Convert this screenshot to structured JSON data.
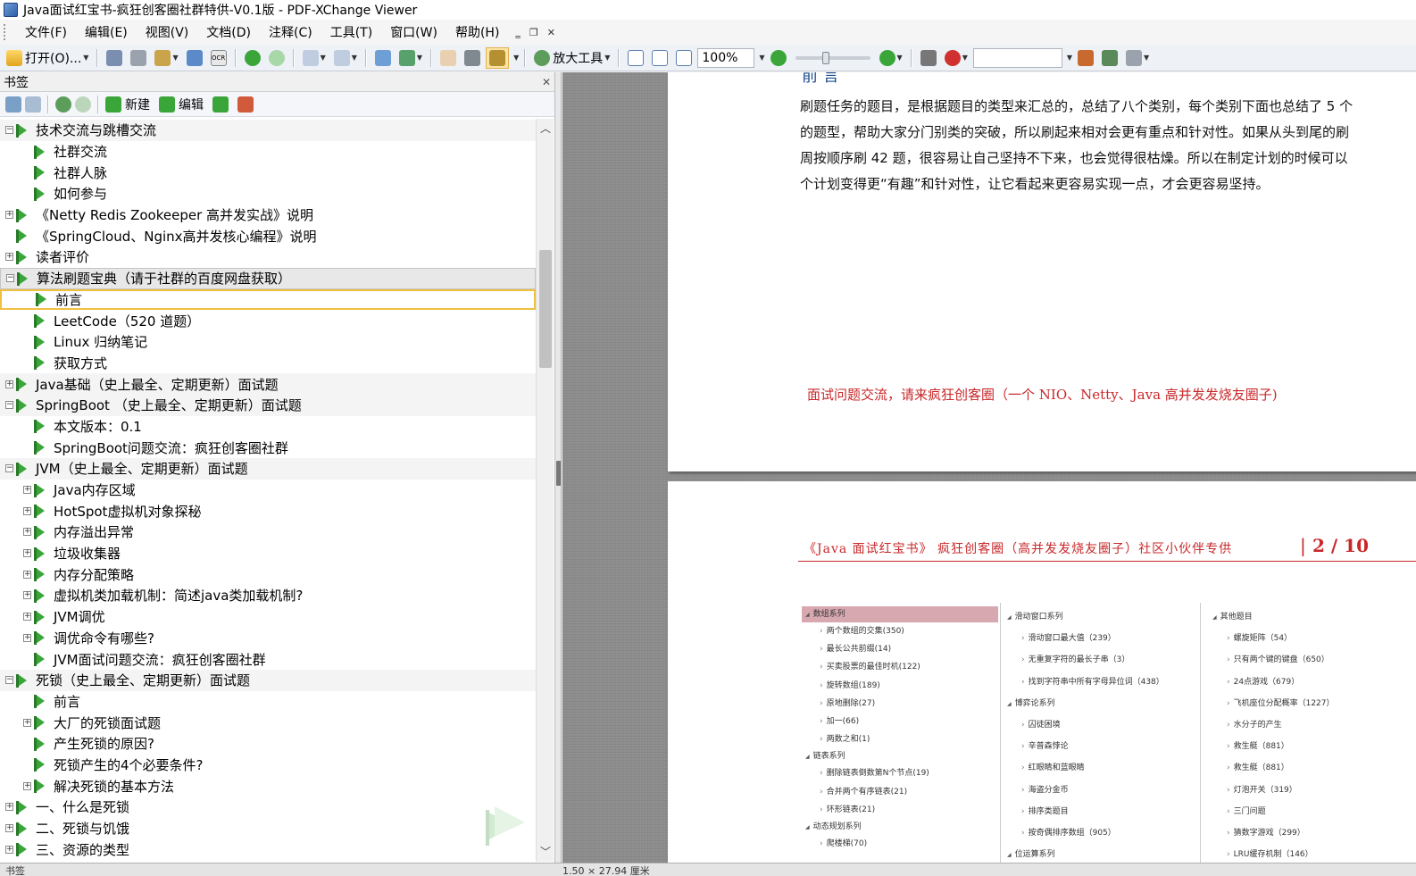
{
  "window": {
    "title": "Java面试红宝书-疯狂创客圈社群特供-V0.1版 - PDF-XChange Viewer"
  },
  "menu": [
    "文件(F)",
    "编辑(E)",
    "视图(V)",
    "文档(D)",
    "注释(C)",
    "工具(T)",
    "窗口(W)",
    "帮助(H)"
  ],
  "toolbar": {
    "open_label": "打开(O)...",
    "zoom_tool_label": "放大工具",
    "zoom_value": "100%"
  },
  "bookmarks": {
    "title": "书签",
    "new_label": "新建",
    "edit_label": "编辑",
    "items": [
      {
        "level": 0,
        "label": "技术交流与跳槽交流",
        "exp": "minus",
        "section": true
      },
      {
        "level": 1,
        "label": "社群交流",
        "exp": "none"
      },
      {
        "level": 1,
        "label": "社群人脉",
        "exp": "none"
      },
      {
        "level": 1,
        "label": "如何参与",
        "exp": "none"
      },
      {
        "level": 0,
        "label": "《Netty Redis Zookeeper 高并发实战》说明",
        "exp": "plus"
      },
      {
        "level": 0,
        "label": "《SpringCloud、Nginx高并发核心编程》说明",
        "exp": "none"
      },
      {
        "level": 0,
        "label": "读者评价",
        "exp": "plus"
      },
      {
        "level": 0,
        "label": "算法刷题宝典（请于社群的百度网盘获取）",
        "exp": "minus",
        "selected": true
      },
      {
        "level": 1,
        "label": "前言",
        "exp": "none",
        "current": true
      },
      {
        "level": 1,
        "label": "LeetCode（520 道题）",
        "exp": "none"
      },
      {
        "level": 1,
        "label": "Linux 归纳笔记",
        "exp": "none"
      },
      {
        "level": 1,
        "label": "获取方式",
        "exp": "none"
      },
      {
        "level": 0,
        "label": "Java基础（史上最全、定期更新）面试题",
        "exp": "plus",
        "section": true
      },
      {
        "level": 0,
        "label": "SpringBoot （史上最全、定期更新）面试题",
        "exp": "minus",
        "section": true
      },
      {
        "level": 1,
        "label": "本文版本：0.1",
        "exp": "none"
      },
      {
        "level": 1,
        "label": "SpringBoot问题交流：疯狂创客圈社群",
        "exp": "none"
      },
      {
        "level": 0,
        "label": "JVM（史上最全、定期更新）面试题",
        "exp": "minus",
        "section": true
      },
      {
        "level": 1,
        "label": "Java内存区域",
        "exp": "plus"
      },
      {
        "level": 1,
        "label": "HotSpot虚拟机对象探秘",
        "exp": "plus"
      },
      {
        "level": 1,
        "label": "内存溢出异常",
        "exp": "plus"
      },
      {
        "level": 1,
        "label": "垃圾收集器",
        "exp": "plus"
      },
      {
        "level": 1,
        "label": "内存分配策略",
        "exp": "plus"
      },
      {
        "level": 1,
        "label": "虚拟机类加载机制：简述java类加载机制?",
        "exp": "plus"
      },
      {
        "level": 1,
        "label": "JVM调优",
        "exp": "plus"
      },
      {
        "level": 1,
        "label": "调优命令有哪些?",
        "exp": "plus"
      },
      {
        "level": 1,
        "label": "JVM面试问题交流：疯狂创客圈社群",
        "exp": "none"
      },
      {
        "level": 0,
        "label": "死锁（史上最全、定期更新）面试题",
        "exp": "minus",
        "section": true
      },
      {
        "level": 1,
        "label": "前言",
        "exp": "none"
      },
      {
        "level": 1,
        "label": "大厂的死锁面试题",
        "exp": "plus"
      },
      {
        "level": 1,
        "label": "产生死锁的原因?",
        "exp": "none"
      },
      {
        "level": 1,
        "label": "死锁产生的4个必要条件?",
        "exp": "none"
      },
      {
        "level": 1,
        "label": "解决死锁的基本方法",
        "exp": "plus"
      },
      {
        "level": 0,
        "label": "一、什么是死锁",
        "exp": "plus"
      },
      {
        "level": 0,
        "label": "二、死锁与饥饿",
        "exp": "plus"
      },
      {
        "level": 0,
        "label": "三、资源的类型",
        "exp": "plus"
      }
    ]
  },
  "document": {
    "page1": {
      "heading_partial": "前 言",
      "paragraph_lines": [
        "刷题任务的题目，是根据题目的类型来汇总的，总结了八个类别，每个类别下面也总结了 5 个",
        "的题型，帮助大家分门别类的突破，所以刷起来相对会更有重点和针对性。如果从头到尾的刷",
        "周按顺序刷 42 题，很容易让自己坚持不下来，也会觉得很枯燥。所以在制定计划的时候可以",
        "个计划变得更“有趣”和针对性，让它看起来更容易实现一点，才会更容易坚持。"
      ],
      "promo": "面试问题交流，请来疯狂创客圈（一个 NIO、Netty、Java 高并发发烧友圈子)"
    },
    "page2": {
      "header_text": "《Java 面试红宝书》  疯狂创客圈（高并发发烧友圈子）社区小伙伴专供",
      "header_sep": "|",
      "page_num": "2 / 10",
      "columns": [
        {
          "groups": [
            {
              "title": "数组系列",
              "highlight": true,
              "items": [
                "两个数组的交集(350)",
                "最长公共前缀(14)",
                "买卖股票的最佳时机(122)",
                "旋转数组(189)",
                "原地删除(27)",
                "加一(66)",
                "两数之和(1)"
              ]
            },
            {
              "title": "链表系列",
              "items": [
                "删除链表倒数第N个节点(19)",
                "合并两个有序链表(21)",
                "环形链表(21)"
              ]
            },
            {
              "title": "动态规划系列",
              "items": [
                "爬楼梯(70)"
              ]
            }
          ]
        },
        {
          "groups": [
            {
              "title": "滑动窗口系列",
              "items": [
                "滑动窗口最大值（239）",
                "无重复字符的最长子串（3）",
                "找到字符串中所有字母异位词（438）"
              ]
            },
            {
              "title": "博弈论系列",
              "items": [
                "囚徒困境",
                "辛普森悖论",
                "红眼睛和蓝眼睛",
                "海盗分金币",
                "排序类题目",
                "按奇偶排序数组（905）"
              ]
            },
            {
              "title": "位运算系列",
              "items": []
            }
          ]
        },
        {
          "groups": [
            {
              "title": "其他题目",
              "items": [
                "螺旋矩阵（54）",
                "只有两个键的键盘（650）",
                "24点游戏（679）",
                "飞机座位分配概率（1227）",
                "水分子的产生",
                "救生艇（881）",
                "救生艇（881）",
                "灯泡开关（319）",
                "三门问题",
                "猜数字游戏（299）",
                "LRU缓存机制（146）"
              ]
            }
          ]
        }
      ]
    }
  },
  "statusbar": {
    "left": "书签",
    "mid": "1.50 × 27.94 厘米"
  },
  "colors": {
    "accent_red": "#c8282a",
    "bookmark_green": "#3aa63a"
  }
}
